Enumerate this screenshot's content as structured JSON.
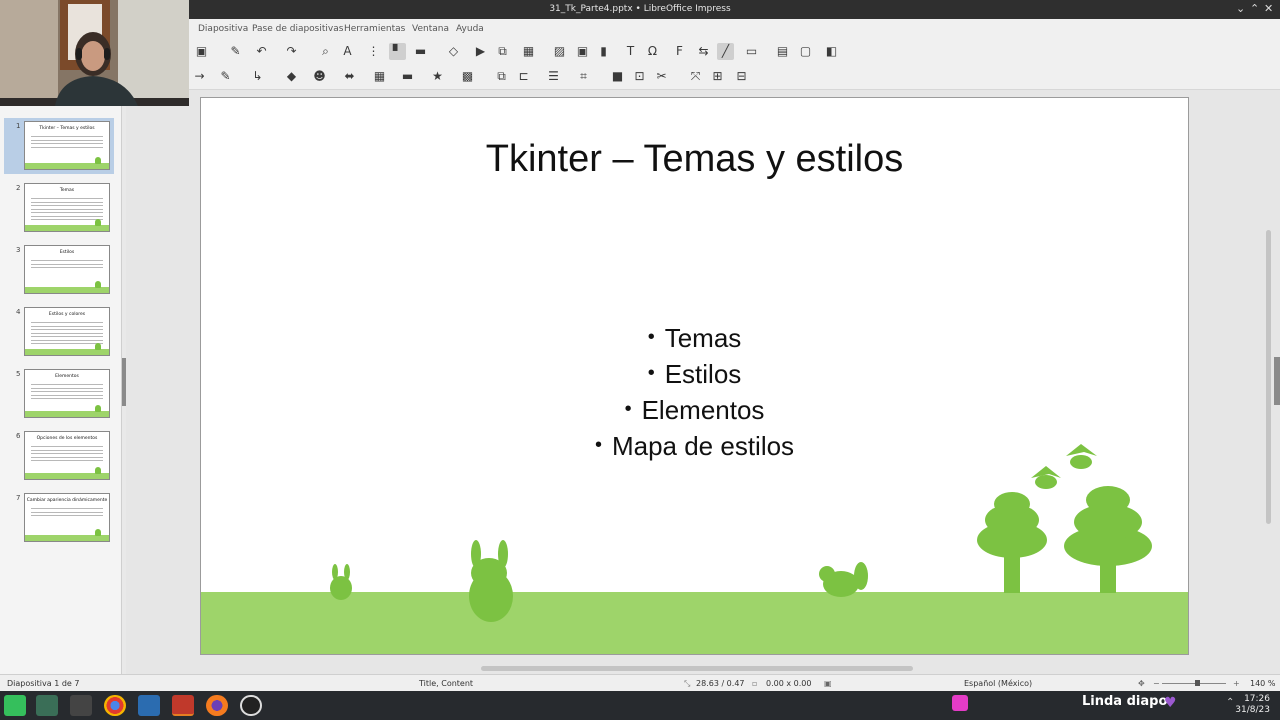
{
  "window": {
    "title": "31_Tk_Parte4.pptx • LibreOffice Impress"
  },
  "menu": {
    "items": [
      "Diapositiva",
      "Pase de diapositivas",
      "Herramientas",
      "Ventana",
      "Ayuda"
    ]
  },
  "slides": [
    {
      "num": "1",
      "title": "Tkinter – Temas y estilos",
      "lines": 4,
      "selected": true
    },
    {
      "num": "2",
      "title": "Temas",
      "lines": 7,
      "selected": false
    },
    {
      "num": "3",
      "title": "Estilos",
      "lines": 3,
      "selected": false
    },
    {
      "num": "4",
      "title": "Estilos y colores",
      "lines": 7,
      "selected": false
    },
    {
      "num": "5",
      "title": "Elementos",
      "lines": 5,
      "selected": false
    },
    {
      "num": "6",
      "title": "Opciones de los elementos",
      "lines": 5,
      "selected": false
    },
    {
      "num": "7",
      "title": "Cambiar apariencia dinámicamente",
      "lines": 3,
      "selected": false
    }
  ],
  "current_slide": {
    "title": "Tkinter – Temas y estilos",
    "bullets": [
      "Temas",
      "Estilos",
      "Elementos",
      "Mapa de estilos"
    ]
  },
  "status": {
    "slide_info": "Diapositiva 1 de 7",
    "layout": "Title, Content",
    "position": "28.63 / 0.47",
    "size": "0.00 x 0.00",
    "language": "Español (México)",
    "zoom": "140 %"
  },
  "taskbar": {
    "tray_text": "Linda diapo",
    "time": "17:26",
    "date": "31/8/23"
  },
  "colors": {
    "grass": "#9ed46a",
    "tree": "#7cc242",
    "accent": "#b9cee6"
  }
}
